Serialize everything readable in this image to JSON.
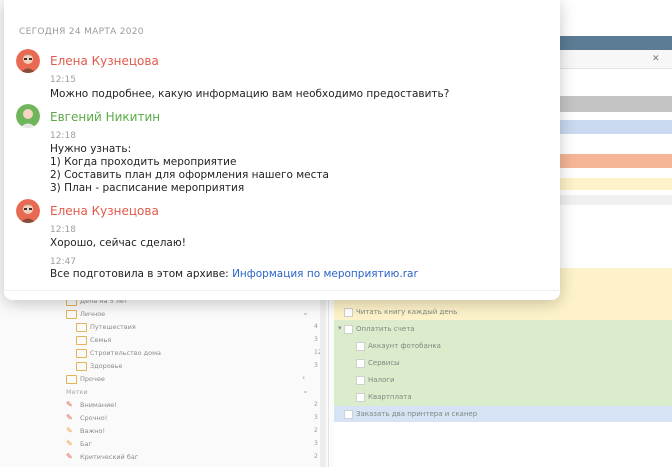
{
  "chat": {
    "date_header": "СЕГОДНЯ 24 МАРТА 2020",
    "messages": [
      {
        "author": "Елена Кузнецова",
        "author_color": "#e0594a",
        "time": "12:15",
        "lines": [
          "Можно подробнее, какую информацию вам необходимо предоставить?"
        ]
      },
      {
        "author": "Евгений Никитин",
        "author_color": "#5aab46",
        "time": "12:18",
        "lines": [
          "Нужно узнать:",
          "1) Когда проходить мероприятие",
          "2) Составить план для оформления нашего места",
          "3) План - расписание мероприятия"
        ]
      },
      {
        "author": "Елена Кузнецова",
        "author_color": "#e0594a",
        "time": "12:18",
        "lines": [
          "Хорошо, сейчас сделаю!"
        ]
      },
      {
        "time": "12:47",
        "text_prefix": "Все подготовила в этом архиве: ",
        "link_text": "Информация по мероприятию.rar"
      }
    ]
  },
  "sidebar": {
    "items": [
      {
        "label": "Дела на 5 лет",
        "count": ""
      },
      {
        "label": "Личное",
        "count": ""
      },
      {
        "label": "Путешествия",
        "count": "4"
      },
      {
        "label": "Семья",
        "count": "3"
      },
      {
        "label": "Строительство дома",
        "count": "12"
      },
      {
        "label": "Здоровье",
        "count": "3"
      },
      {
        "label": "Прочее",
        "count": ""
      }
    ],
    "tags_label": "Метки",
    "tags": [
      {
        "label": "Внимание!",
        "count": "2",
        "color": "#e05a4a"
      },
      {
        "label": "Срочно!",
        "count": "3",
        "color": "#e05a4a"
      },
      {
        "label": "Важно!",
        "count": "2",
        "color": "#e8a33a"
      },
      {
        "label": "Баг",
        "count": "3",
        "color": "#e8a33a"
      },
      {
        "label": "Критический баг",
        "count": "2",
        "color": "#e05a4a"
      }
    ]
  },
  "tasks": {
    "items": [
      {
        "title": "Читать книгу каждый день"
      },
      {
        "title": "Оплатить счета"
      },
      {
        "title": "Аккаунт фотобанка"
      },
      {
        "title": "Сервисы"
      },
      {
        "title": "Налоги"
      },
      {
        "title": "Квартплата"
      },
      {
        "title": "Заказать два принтера и сканер"
      }
    ]
  },
  "colors": {
    "blue_band": "#c9d9ef",
    "gray_band": "#c4c4c4",
    "orange_band": "#f4b696",
    "yellow_band": "#fdf2c9",
    "green_band": "#dbeccd",
    "header_band": "#5b7c94",
    "link": "#2b64c8"
  }
}
